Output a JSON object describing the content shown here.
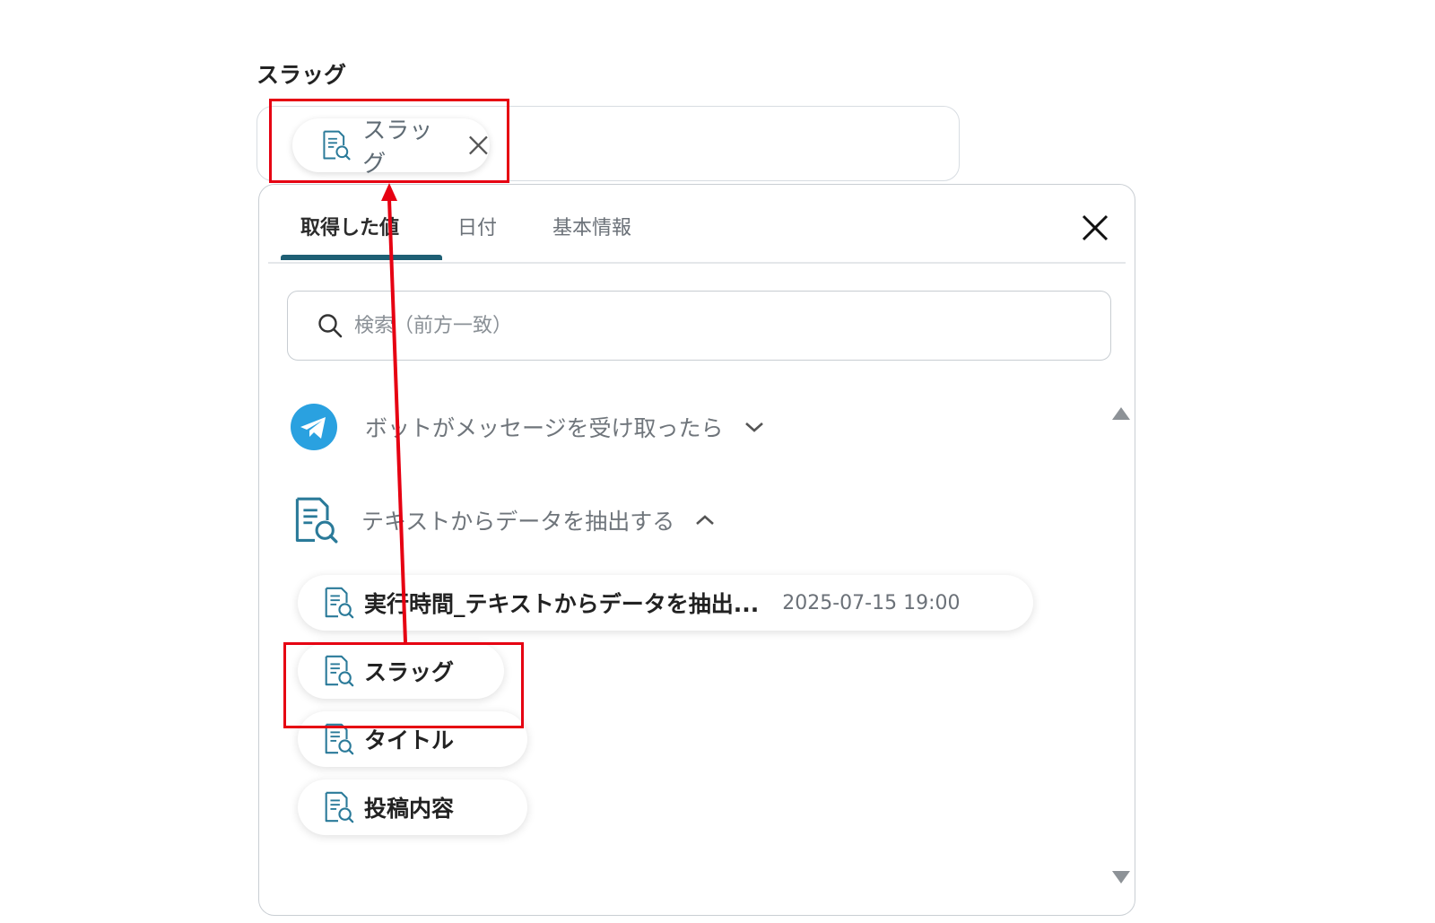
{
  "field": {
    "label": "スラッグ",
    "chip_label": "スラッグ"
  },
  "panel": {
    "tabs": [
      {
        "label": "取得した値",
        "active": true
      },
      {
        "label": "日付",
        "active": false
      },
      {
        "label": "基本情報",
        "active": false
      }
    ],
    "search_placeholder": "検索（前方一致）",
    "groups": [
      {
        "icon": "telegram-icon",
        "label": "ボットがメッセージを受け取ったら",
        "expanded": false
      },
      {
        "icon": "extract-data-icon",
        "label": "テキストからデータを抽出する",
        "expanded": true
      }
    ],
    "items": [
      {
        "label": "実行時間_テキストからデータを抽出...",
        "value": "2025-07-15 19:00"
      },
      {
        "label": "スラッグ",
        "value": ""
      },
      {
        "label": "タイトル",
        "value": ""
      },
      {
        "label": "投稿内容",
        "value": ""
      }
    ]
  },
  "colors": {
    "accent": "#1e5f74",
    "icon": "#2a7a99",
    "telegram": "#2aa1e0",
    "annotation": "#e60012"
  }
}
